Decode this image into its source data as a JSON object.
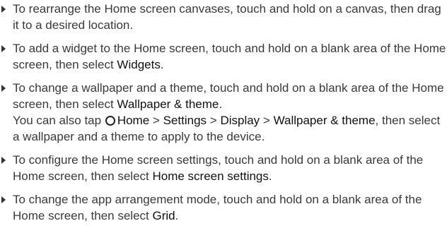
{
  "items": [
    {
      "text": "To rearrange the Home screen canvases, touch and hold on a canvas, then drag it to a desired location."
    },
    {
      "text": "To add a widget to the Home screen, touch and hold on a blank area of the Home screen, then select ",
      "emph": "Widgets",
      "tail": "."
    },
    {
      "text": "To change a wallpaper and a theme, touch and hold on a blank area of the Home screen, then select ",
      "emph": "Wallpaper & theme",
      "tail": ".",
      "extra": {
        "lead": "You can also tap",
        "icon": "home-circle-icon",
        "path": [
          "Home",
          "Settings",
          "Display",
          "Wallpaper & theme"
        ],
        "sep": ">",
        "trail": ", then select a wallpaper and a theme to apply to the device."
      }
    },
    {
      "text": "To configure the Home screen settings, touch and hold on a blank area of the Home screen, then select ",
      "emph": "Home screen settings",
      "tail": "."
    },
    {
      "text": "To change the app arrangement mode, touch and hold on a blank area of the Home screen, then select ",
      "emph": "Grid",
      "tail": "."
    }
  ]
}
